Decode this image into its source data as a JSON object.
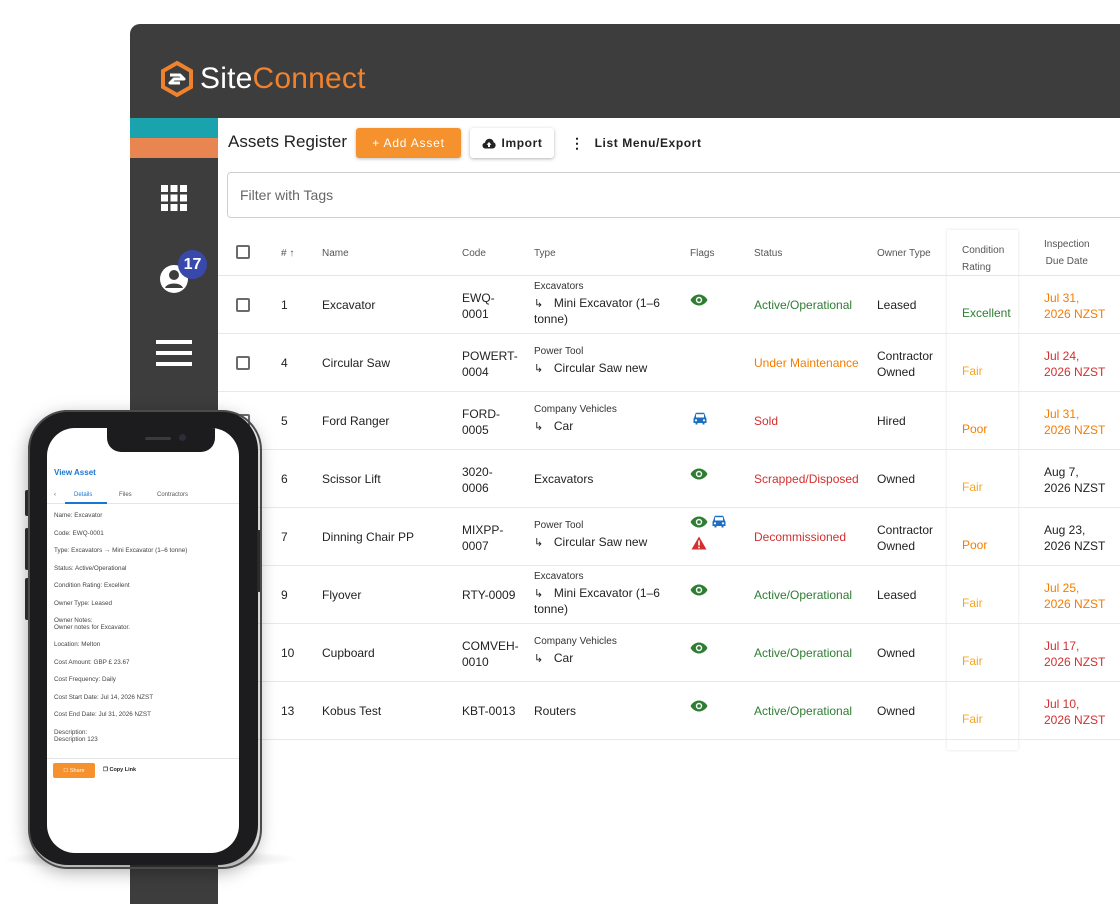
{
  "brand": {
    "site": "Site",
    "connect": "Connect"
  },
  "colors": {
    "accent": "#f5922e",
    "topbar": "#3d3d3d",
    "teal": "#1aa3ad",
    "active": "#2e7d32",
    "maintenance": "#f57c00",
    "sold": "#d32f2f",
    "badge": "#3949ab"
  },
  "sidebar": {
    "badge_count": "17"
  },
  "toolbar": {
    "title": "Assets Register",
    "add_label": "+ Add Asset",
    "import_label": "Import",
    "list_label": "List Menu/Export"
  },
  "filter": {
    "placeholder": "Filter with Tags"
  },
  "table": {
    "headers": {
      "num": "#",
      "name": "Name",
      "code": "Code",
      "type": "Type",
      "flags": "Flags",
      "status": "Status",
      "owner": "Owner Type",
      "condition_1": "Condition",
      "condition_2": "Rating",
      "due_1": "Inspection",
      "due_2": "Due Date"
    },
    "rows": [
      {
        "num": "1",
        "name": "Excavator",
        "code1": "EWQ-",
        "code2": "0001",
        "type_parent": "Excavators",
        "type_child": "Mini Excavator (1–6",
        "type_child2": "tonne)",
        "status": "Active/Operational",
        "owner1": "Leased",
        "owner2": "",
        "condition": "Excellent",
        "due1": "Jul 31,",
        "due2": "2026 NZST"
      },
      {
        "num": "4",
        "name": "Circular Saw",
        "code1": "POWERT-",
        "code2": "0004",
        "type_parent": "Power Tool",
        "type_child": "Circular Saw new",
        "type_child2": "",
        "status": "Under Maintenance",
        "owner1": "Contractor",
        "owner2": "Owned",
        "condition": "Fair",
        "due1": "Jul 24,",
        "due2": "2026 NZST"
      },
      {
        "num": "5",
        "name": "Ford Ranger",
        "code1": "FORD-",
        "code2": "0005",
        "type_parent": "Company Vehicles",
        "type_child": "Car",
        "type_child2": "",
        "status": "Sold",
        "owner1": "Hired",
        "owner2": "",
        "condition": "Poor",
        "due1": "Jul 31,",
        "due2": "2026 NZST"
      },
      {
        "num": "6",
        "name": "Scissor Lift",
        "code1": "3020-",
        "code2": "0006",
        "type_parent": "",
        "type_child": "Excavators",
        "type_child2": "",
        "status": "Scrapped/Disposed",
        "owner1": "Owned",
        "owner2": "",
        "condition": "Fair",
        "due1": "Aug 7,",
        "due2": "2026 NZST"
      },
      {
        "num": "7",
        "name": "Dinning Chair PP",
        "code1": "MIXPP-",
        "code2": "0007",
        "type_parent": "Power Tool",
        "type_child": "Circular Saw new",
        "type_child2": "",
        "status": "Decommissioned",
        "owner1": "Contractor",
        "owner2": "Owned",
        "condition": "Poor",
        "due1": "Aug 23,",
        "due2": "2026 NZST"
      },
      {
        "num": "9",
        "name": "Flyover",
        "code1": "RTY-0009",
        "code2": "",
        "type_parent": "Excavators",
        "type_child": "Mini Excavator (1–6",
        "type_child2": "tonne)",
        "status": "Active/Operational",
        "owner1": "Leased",
        "owner2": "",
        "condition": "Fair",
        "due1": "Jul 25,",
        "due2": "2026 NZST"
      },
      {
        "num": "10",
        "name": "Cupboard",
        "code1": "COMVEH-",
        "code2": "0010",
        "type_parent": "Company Vehicles",
        "type_child": "Car",
        "type_child2": "",
        "status": "Active/Operational",
        "owner1": "Owned",
        "owner2": "",
        "condition": "Fair",
        "due1": "Jul 17,",
        "due2": "2026 NZST"
      },
      {
        "num": "13",
        "name": "Kobus Test",
        "code1": "KBT-0013",
        "code2": "",
        "type_parent": "",
        "type_child": "Routers",
        "type_child2": "",
        "status": "Active/Operational",
        "owner1": "Owned",
        "owner2": "",
        "condition": "Fair",
        "due1": "Jul 10,",
        "due2": "2026 NZST"
      }
    ]
  },
  "phone": {
    "title": "View Asset",
    "tabs": [
      "Details",
      "Files",
      "Contractors"
    ],
    "fields": [
      "Name: Excavator",
      "Code: EWQ-0001",
      "Type: Excavators → Mini Excavator (1–6 tonne)",
      "Status: Active/Operational",
      "Condition Rating: Excellent",
      "Owner Type: Leased",
      "Owner Notes:",
      "Owner notes for Excavator.",
      "Location: Melton",
      "Cost Amount: GBP £ 23.67",
      "Cost Frequency: Daily",
      "Cost Start Date: Jul 14, 2026 NZST",
      "Cost End Date: Jul 31, 2026 NZST",
      "Description:",
      "Description 123"
    ],
    "share_label": "Share",
    "copy_label": "Copy Link"
  }
}
